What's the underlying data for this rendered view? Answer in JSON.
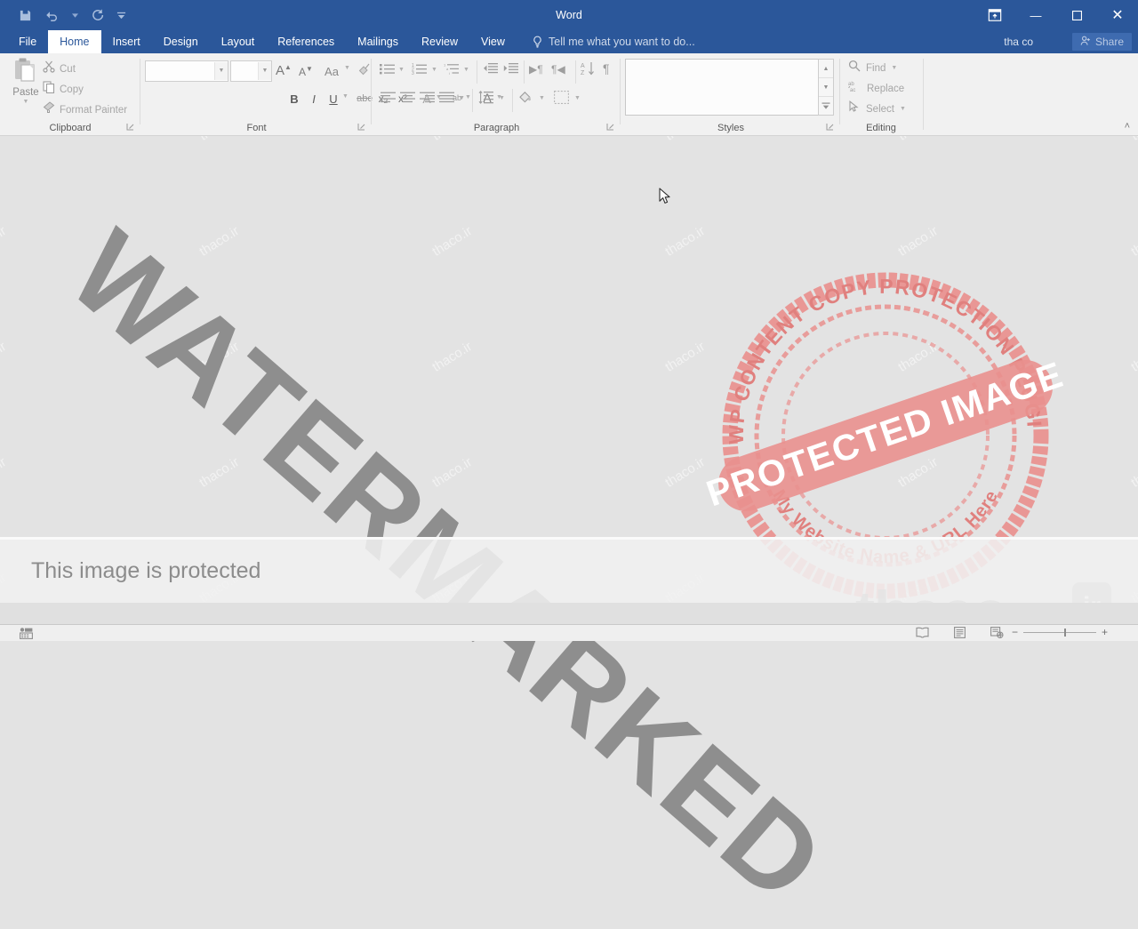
{
  "app": {
    "window_title": "Word",
    "account_name": "tha co",
    "share_label": "Share"
  },
  "quick_access": {
    "items": [
      {
        "name": "save-icon",
        "glyph": "save"
      },
      {
        "name": "undo-icon",
        "glyph": "undo"
      },
      {
        "name": "redo-icon",
        "glyph": "redo"
      },
      {
        "name": "customize-quick-access-icon",
        "glyph": "caret-bar"
      }
    ]
  },
  "window_controls": {
    "ribbon_display_options": "ribbon-display-options",
    "minimize": "—",
    "maximize": "☐",
    "close": "✕"
  },
  "tabs": [
    {
      "label": "File",
      "active": false
    },
    {
      "label": "Home",
      "active": true
    },
    {
      "label": "Insert",
      "active": false
    },
    {
      "label": "Design",
      "active": false
    },
    {
      "label": "Layout",
      "active": false
    },
    {
      "label": "References",
      "active": false
    },
    {
      "label": "Mailings",
      "active": false
    },
    {
      "label": "Review",
      "active": false
    },
    {
      "label": "View",
      "active": false
    }
  ],
  "tell_me": {
    "placeholder": "Tell me what you want to do..."
  },
  "ribbon": {
    "groups": [
      {
        "name": "clipboard",
        "label": "Clipboard"
      },
      {
        "name": "font",
        "label": "Font"
      },
      {
        "name": "paragraph",
        "label": "Paragraph"
      },
      {
        "name": "styles",
        "label": "Styles"
      },
      {
        "name": "editing",
        "label": "Editing"
      }
    ],
    "clipboard": {
      "paste_label": "Paste",
      "cut_label": "Cut",
      "copy_label": "Copy",
      "format_painter_label": "Format Painter"
    },
    "font": {
      "font_name_value": "",
      "font_size_value": "",
      "grow_font": "A",
      "shrink_font": "A",
      "change_case": "Aa",
      "clear_formatting": "clear-formatting",
      "bold": "B",
      "italic": "I",
      "underline": "U",
      "strikethrough": "abc",
      "subscript": "x₂",
      "superscript": "x²",
      "text_effects": "A",
      "text_highlight": "ab",
      "font_color": "A"
    },
    "editing": {
      "find_label": "Find",
      "replace_label": "Replace",
      "select_label": "Select"
    },
    "collapse_ribbon": "˄"
  },
  "overlays": {
    "watermark_text": "WATERMARKED",
    "tile_text": "thaco.ir",
    "brand_text": "thaco",
    "badge_text": "ir",
    "protected_banner_text": "This image is protected",
    "stamp": {
      "top_arc_text": "WP CONTENT COPY PROTECTION PLUGIN",
      "bottom_arc_text": "My Website Name & URL Here",
      "banner_text": "PROTECTED IMAGE"
    }
  },
  "status_bar": {
    "view_read_mode": "read-mode",
    "view_print_layout": "print-layout",
    "view_web_layout": "web-layout",
    "zoom_out": "−",
    "zoom_in": "+"
  },
  "colors": {
    "ribbon_accent": "#2b579a",
    "stamp_red": "#e9908e",
    "canvas": "#e3e3e3"
  }
}
